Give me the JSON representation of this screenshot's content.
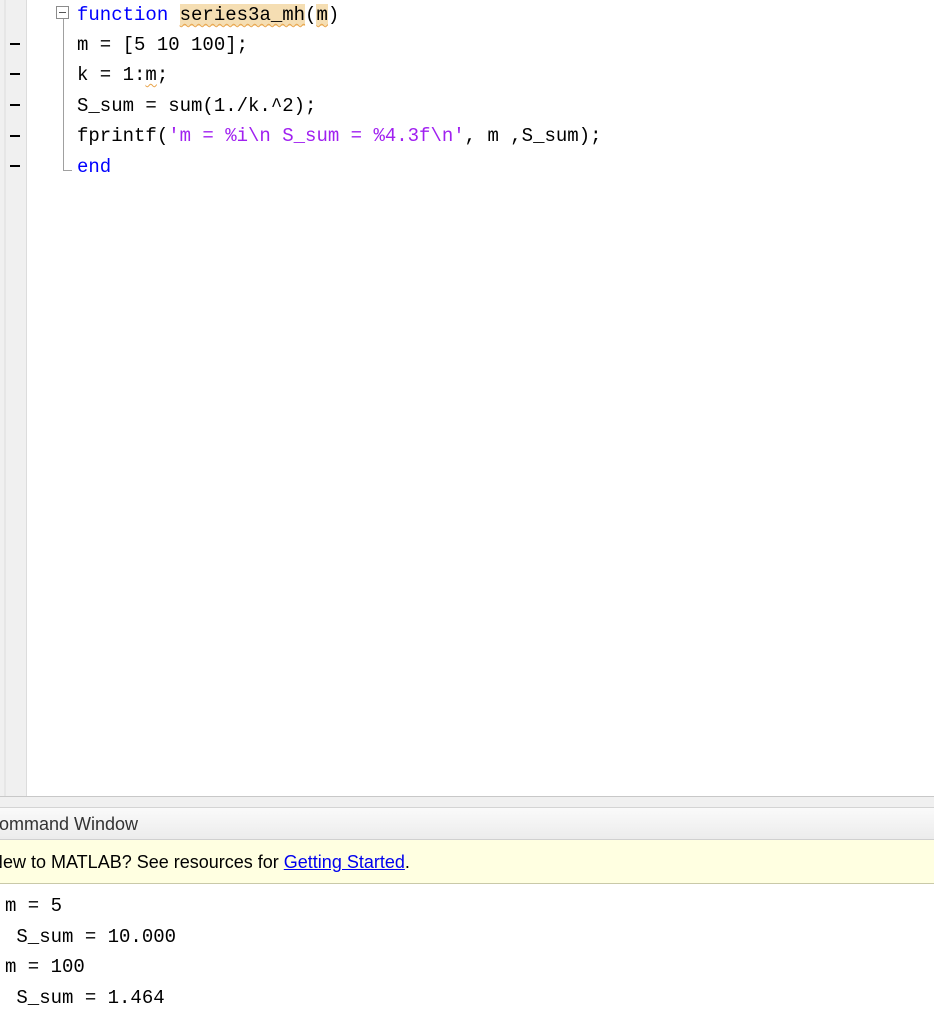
{
  "editor": {
    "lines": [
      {
        "kw": "function",
        "sp": " ",
        "fname": "series3a_mh",
        "arg_open": "(",
        "arg": "m",
        "arg_close": ")"
      },
      {
        "text": "m = [5 10 100];"
      },
      {
        "pre": "k = 1:",
        "var": "m",
        "post": ";"
      },
      {
        "text": "S_sum = sum(1./k.^2);"
      },
      {
        "pre": "fprintf(",
        "str": "'m = %i\\n S_sum = %4.3f\\n'",
        "post": ", m ,S_sum);"
      },
      {
        "kw": "end"
      }
    ]
  },
  "command_window": {
    "title": "Command Window",
    "info_prefix": "New to MATLAB? See resources for ",
    "info_link": "Getting Started",
    "info_suffix": ".",
    "output": [
      "m = 5",
      " S_sum = 10.000",
      "m = 100",
      " S_sum = 1.464"
    ]
  }
}
